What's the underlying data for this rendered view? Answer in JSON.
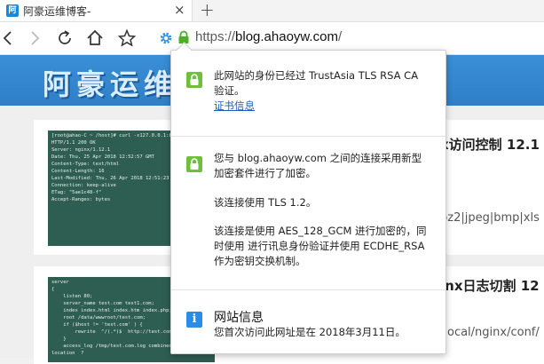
{
  "tab": {
    "title": "阿豪运维博客-",
    "favicon_char": "阿",
    "close": "×",
    "new_tab": "+"
  },
  "address": {
    "scheme": "https://",
    "host": "blog.ahaoyw.com",
    "path": "/"
  },
  "banner": {
    "logo_text": "阿豪运维"
  },
  "posts": [
    {
      "title": "x访问控制 12.1",
      "tags": "bz2|jpeg|bmp|xls",
      "terminal": "[root@ahao-C ~ /host]# curl -x127.0.0.1:80 test.com\nHTTP/1.1 200 OK\nServer: nginx/1.12.1\nDate: Thu, 25 Apr 2018 12:52:57 GMT\nContent-Type: text/html\nContent-Length: 16\nLast-Modified: Thu, 26 Apr 2018 12:51:23 GMT\nConnection: keep-alive\nETag: \"5ae1c48-f\"\nAccept-Ranges: bytes"
    },
    {
      "title": "inx日志切割 12",
      "tags": "/local/nginx/conf/",
      "terminal": "server\n{\n    listen 80;\n    server_name test.com test1.com;\n    index index.html index.htm index.php;\n    root /data/wwwroot/test.com;\n    if ($host != 'test.com' ) {\n        rewrite  ^/(.*)$  http://test.com/$1  {\n    }\n    access_log /tmp/test.com.log combined_real\nlocation  ?"
    }
  ],
  "popup": {
    "identity_text": "此网站的身份已经过 TrustAsia TLS RSA CA 验证。",
    "cert_link": "证书信息",
    "connection_text": "您与 blog.ahaoyw.com 之间的连接采用新型加密套件进行了加密。",
    "tls_text": "该连接使用 TLS 1.2。",
    "cipher_text": "该连接是使用 AES_128_GCM 进行加密的，同时使用  进行讯息身份验证并使用 ECDHE_RSA 作为密钥交换机制。",
    "site_info_title": "网站信息",
    "site_info_text": "您首次访问此网址是在 2018年3月11日。"
  },
  "colors": {
    "accent": "#2f7fc8",
    "lock_green": "#6fbf3f",
    "info_blue": "#2a8ce6",
    "link": "#1a5fb4"
  }
}
